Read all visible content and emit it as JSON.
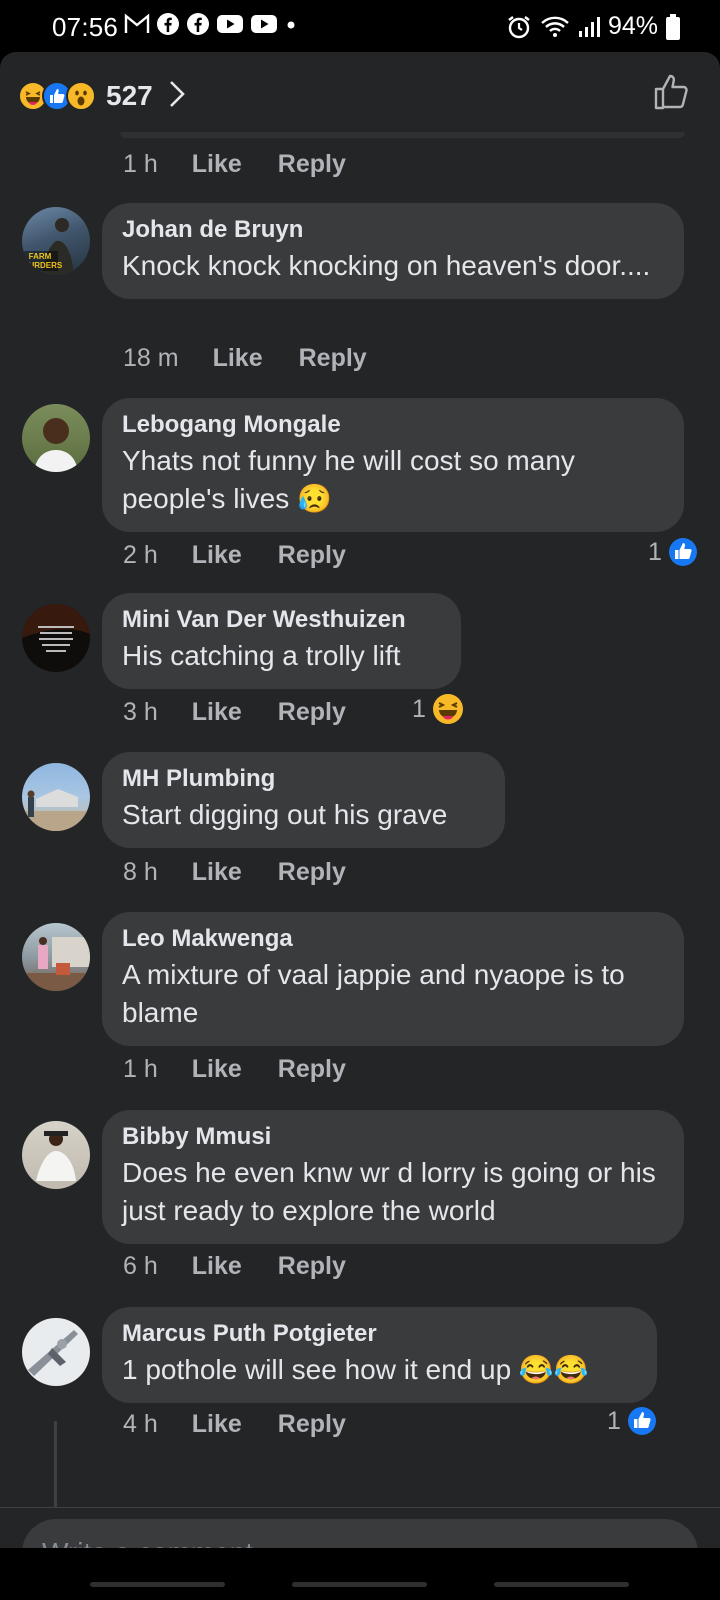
{
  "status_bar": {
    "time": "07:56",
    "notification_icons": [
      "gmail-icon",
      "facebook-icon",
      "facebook-icon",
      "youtube-icon",
      "youtube-icon",
      "dot-icon"
    ],
    "battery": "94%"
  },
  "reactions": {
    "types": [
      "haha",
      "like",
      "wow"
    ],
    "count": "527"
  },
  "top_comment_meta": {
    "time": "1 h",
    "like": "Like",
    "reply": "Reply"
  },
  "comments": [
    {
      "name": "Johan de Bruyn",
      "text": "Knock knock knocking on heaven's door....",
      "time": "18 m",
      "like": "Like",
      "reply": "Reply",
      "reaction_count": "",
      "avatar_text": "FARM MURDERS"
    },
    {
      "name": "Lebogang Mongale",
      "text": "Yhats not funny he will cost so many people's lives 😥",
      "time": "2 h",
      "like": "Like",
      "reply": "Reply",
      "reaction_count": "1",
      "reaction_type": "like"
    },
    {
      "name": "Mini Van Der Westhuizen",
      "text": "His catching a trolly lift",
      "time": "3 h",
      "like": "Like",
      "reply": "Reply",
      "reaction_count": "1",
      "reaction_type": "haha"
    },
    {
      "name": "MH Plumbing",
      "text": "Start digging out his grave",
      "time": "8 h",
      "like": "Like",
      "reply": "Reply",
      "reaction_count": ""
    },
    {
      "name": "Leo Makwenga",
      "text": "A mixture of vaal jappie and nyaope is to blame",
      "time": "1 h",
      "like": "Like",
      "reply": "Reply",
      "reaction_count": ""
    },
    {
      "name": "Bibby Mmusi",
      "text": "Does he even knw wr d lorry is going or his just ready to explore the world",
      "time": "6 h",
      "like": "Like",
      "reply": "Reply",
      "reaction_count": ""
    },
    {
      "name": "Marcus Puth Potgieter",
      "text": "1 pothole will see how it end up 😂😂",
      "time": "4 h",
      "like": "Like",
      "reply": "Reply",
      "reaction_count": "1",
      "reaction_type": "like"
    }
  ],
  "composer": {
    "placeholder": "Write a comment..."
  },
  "colors": {
    "background": "#242526",
    "bubble": "#3a3b3c",
    "text_primary": "#e4e6eb",
    "text_secondary": "#b0b3b8",
    "like_blue": "#1877f2",
    "haha_yellow": "#f7b928"
  }
}
